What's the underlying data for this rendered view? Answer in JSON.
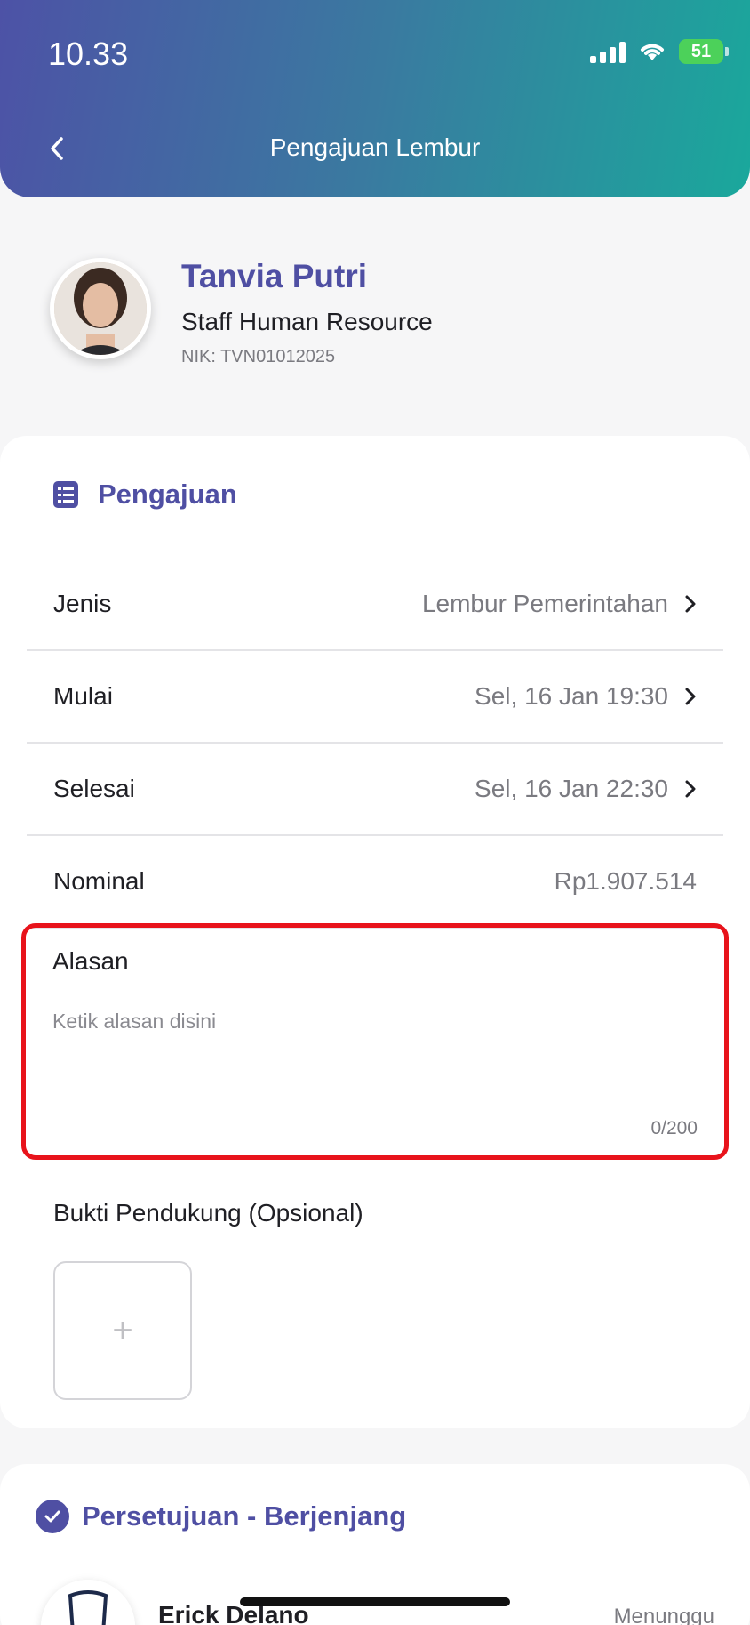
{
  "status_bar": {
    "time": "10.33",
    "battery": "51"
  },
  "header": {
    "title": "Pengajuan Lembur"
  },
  "profile": {
    "name": "Tanvia Putri",
    "role": "Staff Human Resource",
    "nik": "NIK: TVN01012025"
  },
  "pengajuan": {
    "title": "Pengajuan",
    "rows": [
      {
        "label": "Jenis",
        "value": "Lembur Pemerintahan"
      },
      {
        "label": "Mulai",
        "value": "Sel, 16 Jan 19:30"
      },
      {
        "label": "Selesai",
        "value": "Sel, 16 Jan 22:30"
      },
      {
        "label": "Nominal",
        "value": "Rp1.907.514"
      }
    ],
    "reason": {
      "label": "Alasan",
      "placeholder": "Ketik alasan disini",
      "counter": "0/200"
    },
    "proof": {
      "label": "Bukti Pendukung (Opsional)",
      "add": "+"
    }
  },
  "approval": {
    "title": "Persetujuan - Berjenjang",
    "approver": {
      "name": "Erick Delano",
      "status": "Menunggu"
    }
  },
  "colors": {
    "accent": "#4f4fa3",
    "highlight_border": "#e8131b"
  }
}
